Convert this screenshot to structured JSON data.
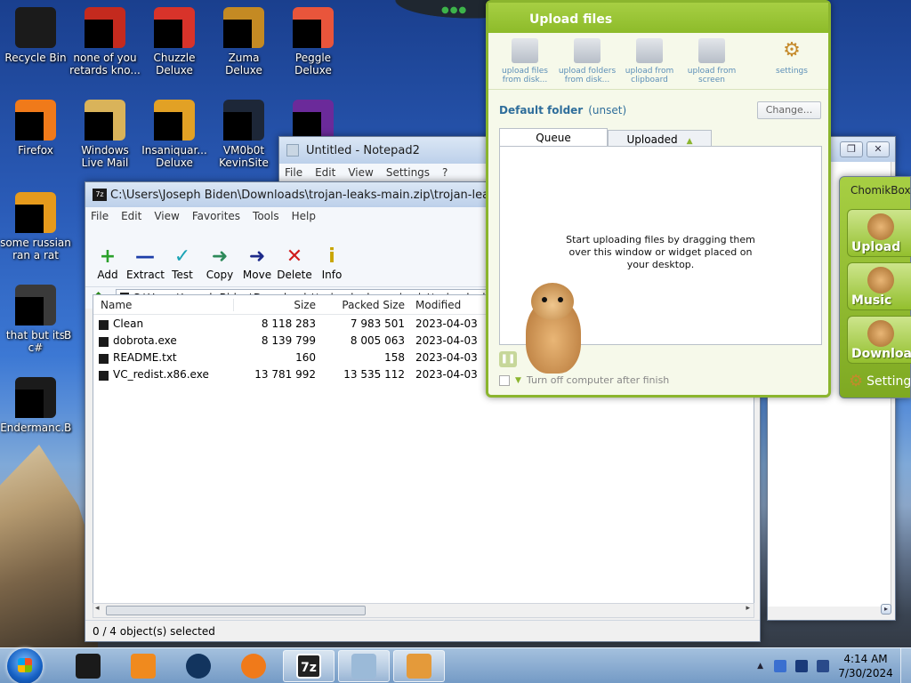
{
  "desktop": {
    "icons": [
      {
        "label": "Recycle Bin",
        "color": "#1b1b1b"
      },
      {
        "label": "none of you retards kno...",
        "color": "#c42a1e"
      },
      {
        "label": "Chuzzle Deluxe",
        "color": "#d8332a"
      },
      {
        "label": "Zuma Deluxe",
        "color": "#c48a23"
      },
      {
        "label": "Peggle Deluxe",
        "color": "#e9553b"
      },
      {
        "label": "Firefox",
        "color": "#f07a1a"
      },
      {
        "label": "Windows Live Mail",
        "color": "#d9b35a"
      },
      {
        "label": "Insaniquar... Deluxe",
        "color": "#e2a125"
      },
      {
        "label": "VM0b0t KevinSite",
        "color": "#1d2738"
      },
      {
        "label": "",
        "color": "#6b2a9a"
      },
      {
        "label": "some russian ran a rat",
        "color": "#e69a1c"
      },
      {
        "label": "that but its c#",
        "color": "#3a3a3a"
      },
      {
        "label": "Endermanc...",
        "color": "#1b1b1b"
      },
      {
        "label": "B",
        "color": "#3a3a3a"
      },
      {
        "label": "B",
        "color": "#3a3a3a"
      }
    ]
  },
  "notepad": {
    "title": "Untitled - Notepad2",
    "menu": [
      "File",
      "Edit",
      "View",
      "Settings",
      "?"
    ]
  },
  "sevenzip": {
    "title": "C:\\Users\\Joseph Biden\\Downloads\\trojan-leaks-main.zip\\trojan-leaks-main\\dob",
    "menu": [
      "File",
      "Edit",
      "View",
      "Favorites",
      "Tools",
      "Help"
    ],
    "toolbar": [
      {
        "label": "Add",
        "glyph": "+",
        "color": "#2ba12b"
      },
      {
        "label": "Extract",
        "glyph": "—",
        "color": "#1d3ea8"
      },
      {
        "label": "Test",
        "glyph": "✓",
        "color": "#1aa3b5"
      },
      {
        "label": "Copy",
        "glyph": "➜",
        "color": "#2d8a5a"
      },
      {
        "label": "Move",
        "glyph": "➜",
        "color": "#1d2a8a"
      },
      {
        "label": "Delete",
        "glyph": "✕",
        "color": "#d01c1c"
      },
      {
        "label": "Info",
        "glyph": "i",
        "color": "#c9a500"
      }
    ],
    "address": "C:\\Users\\Joseph Biden\\Downloads\\trojan-leaks-main.zip\\trojan-leaks-main",
    "columns": {
      "name": "Name",
      "size": "Size",
      "packed": "Packed Size",
      "modified": "Modified"
    },
    "files": [
      {
        "name": "Clean",
        "size": "8 118 283",
        "packed": "7 983 501",
        "modified": "2023-04-03 19:"
      },
      {
        "name": "dobrota.exe",
        "size": "8 139 799",
        "packed": "8 005 063",
        "modified": "2023-04-03 19:"
      },
      {
        "name": "README.txt",
        "size": "160",
        "packed": "158",
        "modified": "2023-04-03 19:"
      },
      {
        "name": "VC_redist.x86.exe",
        "size": "13 781 992",
        "packed": "13 535 112",
        "modified": "2023-04-03 19:"
      }
    ],
    "status": "0 / 4 object(s) selected"
  },
  "upload": {
    "title": "Upload files",
    "tools": [
      {
        "label": "upload files from disk..."
      },
      {
        "label": "upload folders from disk..."
      },
      {
        "label": "upload from clipboard"
      },
      {
        "label": "upload from screen"
      },
      {
        "label": "settings"
      }
    ],
    "default_folder_label": "Default folder",
    "default_folder_value": "(unset)",
    "change_button": "Change...",
    "tabs": {
      "queue": "Queue",
      "uploaded": "Uploaded"
    },
    "empty_message": "Start uploading files by dragging them over this window or widget placed on your desktop.",
    "turn_off": "Turn off computer after finish"
  },
  "chomikbox": {
    "title": "ChomikBox",
    "buttons": [
      "Upload",
      "Music",
      "Download"
    ],
    "settings": "Settings"
  },
  "taskbar": {
    "time": "4:14 AM",
    "date": "7/30/2024",
    "items": [
      {
        "name": "taskbar-app-dark",
        "color": "#1a1a1a",
        "active": false
      },
      {
        "name": "taskbar-media-player",
        "color": "#f08a1e",
        "active": false
      },
      {
        "name": "taskbar-app-globe",
        "color": "#12345e",
        "active": false
      },
      {
        "name": "taskbar-firefox",
        "color": "#f07a1a",
        "active": false
      },
      {
        "name": "taskbar-7zip",
        "color": "#222222",
        "active": true,
        "text": "7z"
      },
      {
        "name": "taskbar-notepad",
        "color": "#9bbad8",
        "active": true
      },
      {
        "name": "taskbar-chomikbox",
        "color": "#e49a3a",
        "active": true
      }
    ]
  }
}
